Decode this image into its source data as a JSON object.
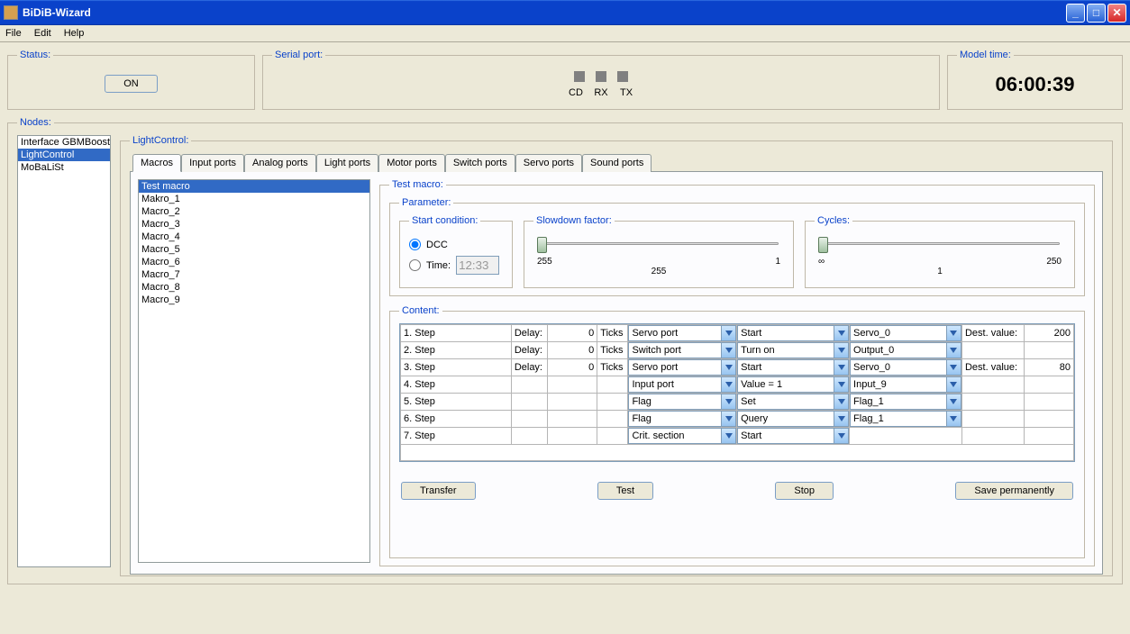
{
  "window": {
    "title": "BiDiB-Wizard"
  },
  "menu": {
    "file": "File",
    "edit": "Edit",
    "help": "Help"
  },
  "status": {
    "legend": "Status:",
    "on_btn": "ON"
  },
  "serial": {
    "legend": "Serial port:",
    "cd": "CD",
    "rx": "RX",
    "tx": "TX"
  },
  "modeltime": {
    "legend": "Model time:",
    "value": "06:00:39"
  },
  "nodes": {
    "legend": "Nodes:",
    "items": [
      "Interface GBMBoost",
      "LightControl",
      "MoBaLiSt"
    ],
    "selected": 1
  },
  "lightcontrol": {
    "legend": "LightControl:",
    "tabs": [
      "Macros",
      "Input ports",
      "Analog ports",
      "Light ports",
      "Motor ports",
      "Switch ports",
      "Servo ports",
      "Sound ports"
    ],
    "active_tab": 0
  },
  "macros": {
    "list": [
      "Test macro",
      "Makro_1",
      "Macro_2",
      "Macro_3",
      "Macro_4",
      "Macro_5",
      "Macro_6",
      "Macro_7",
      "Macro_8",
      "Macro_9"
    ],
    "selected": 0
  },
  "detail": {
    "legend": "Test macro:",
    "param_legend": "Parameter:",
    "start": {
      "legend": "Start condition:",
      "dcc": "DCC",
      "time": "Time:",
      "time_value": "12:33"
    },
    "slowdown": {
      "legend": "Slowdown factor:",
      "min": "255",
      "max": "1",
      "bottom": "255"
    },
    "cycles": {
      "legend": "Cycles:",
      "min": "∞",
      "max": "250",
      "bottom": "1"
    },
    "content_legend": "Content:",
    "steps": [
      {
        "label": "1. Step",
        "delay_lbl": "Delay:",
        "delay": "0",
        "ticks": "Ticks",
        "port": "Servo port",
        "action": "Start",
        "target": "Servo_0",
        "dest_lbl": "Dest. value:",
        "dest": "200"
      },
      {
        "label": "2. Step",
        "delay_lbl": "Delay:",
        "delay": "0",
        "ticks": "Ticks",
        "port": "Switch port",
        "action": "Turn on",
        "target": "Output_0",
        "dest_lbl": "",
        "dest": ""
      },
      {
        "label": "3. Step",
        "delay_lbl": "Delay:",
        "delay": "0",
        "ticks": "Ticks",
        "port": "Servo port",
        "action": "Start",
        "target": "Servo_0",
        "dest_lbl": "Dest. value:",
        "dest": "80"
      },
      {
        "label": "4. Step",
        "delay_lbl": "",
        "delay": "",
        "ticks": "",
        "port": "Input port",
        "action": "Value = 1",
        "target": "Input_9",
        "dest_lbl": "",
        "dest": ""
      },
      {
        "label": "5. Step",
        "delay_lbl": "",
        "delay": "",
        "ticks": "",
        "port": "Flag",
        "action": "Set",
        "target": "Flag_1",
        "dest_lbl": "",
        "dest": ""
      },
      {
        "label": "6. Step",
        "delay_lbl": "",
        "delay": "",
        "ticks": "",
        "port": "Flag",
        "action": "Query",
        "target": "Flag_1",
        "dest_lbl": "",
        "dest": ""
      },
      {
        "label": "7. Step",
        "delay_lbl": "",
        "delay": "",
        "ticks": "",
        "port": "Crit. section",
        "action": "Start",
        "target": "",
        "dest_lbl": "",
        "dest": ""
      }
    ],
    "buttons": {
      "transfer": "Transfer",
      "test": "Test",
      "stop": "Stop",
      "save": "Save permanently"
    }
  }
}
